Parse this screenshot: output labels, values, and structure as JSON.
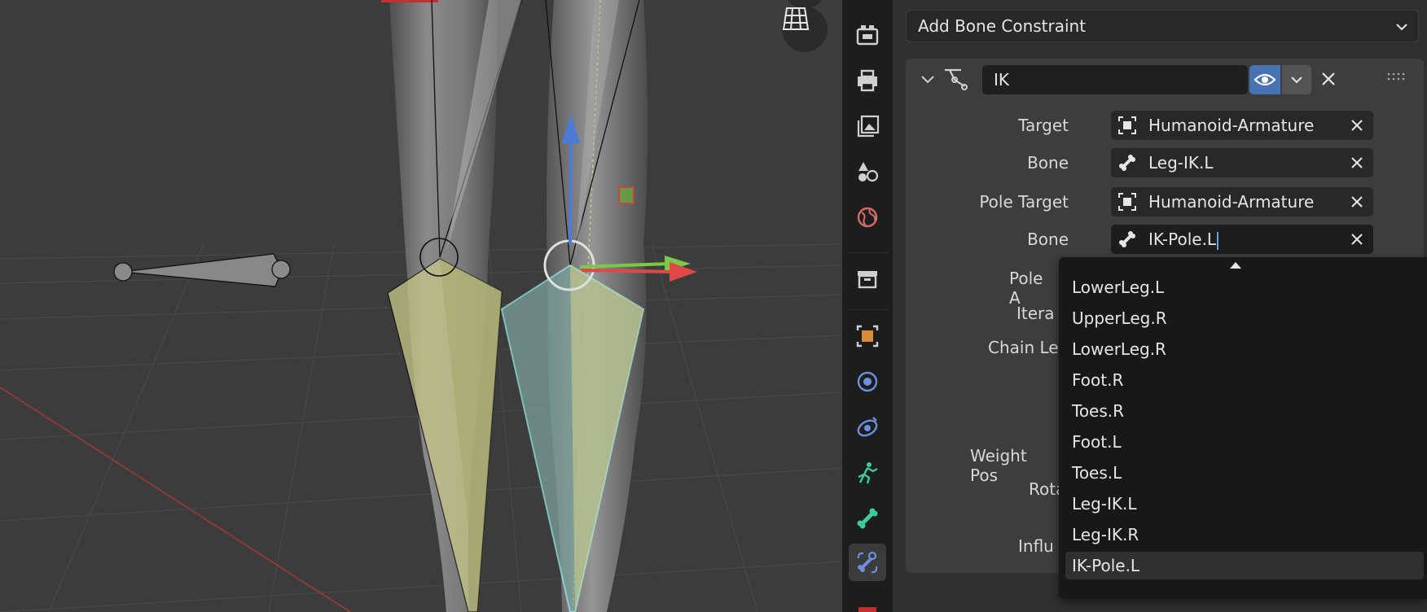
{
  "properties": {
    "add_constraint_label": "Add Bone Constraint",
    "constraint": {
      "name": "IK",
      "fields": [
        {
          "label": "Target",
          "icon": "armature-object-icon",
          "value": "Humanoid-Armature"
        },
        {
          "label": "Bone",
          "icon": "bone-icon",
          "value": "Leg-IK.L"
        },
        {
          "label": "Pole Target",
          "icon": "armature-object-icon",
          "value": "Humanoid-Armature"
        },
        {
          "label": "Bone",
          "icon": "bone-icon",
          "value": "IK-Pole.L"
        }
      ],
      "partial_labels": [
        "Pole A",
        "Itera",
        "Chain Le",
        "Weight Pos",
        "Rota",
        "Influ"
      ]
    }
  },
  "dropdown": {
    "items": [
      "LowerLeg.L",
      "UpperLeg.R",
      "LowerLeg.R",
      "Foot.R",
      "Toes.R",
      "Foot.L",
      "Toes.L",
      "Leg-IK.L",
      "Leg-IK.R",
      "IK-Pole.L"
    ],
    "selected": "IK-Pole.L"
  },
  "tabs": [
    "tool",
    "render",
    "output",
    "view-layer",
    "scene",
    "world",
    "collection",
    "object",
    "modifiers",
    "particles",
    "physics",
    "object-constraints",
    "object-data",
    "bone",
    "bone-constraints"
  ],
  "colors": {
    "accent": "#4772b3",
    "bone_selected": "#9ff5f5",
    "bone_fill": "#c8c88a"
  }
}
